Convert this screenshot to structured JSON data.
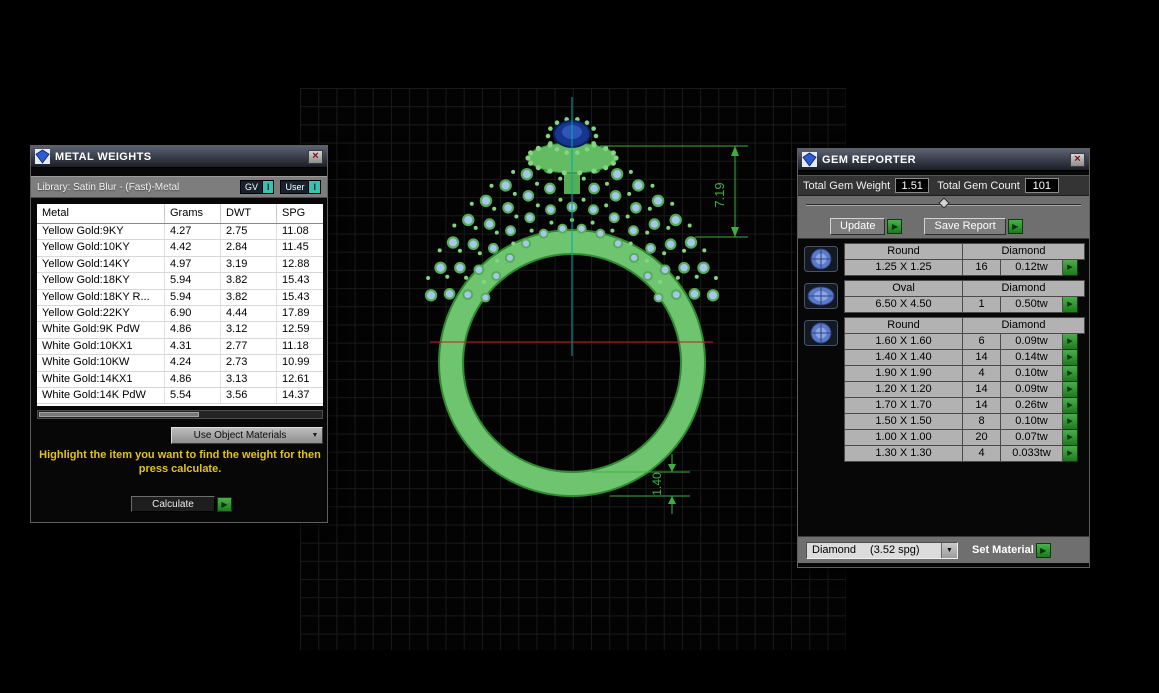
{
  "colors": {
    "accent_green": "#2f9e2f",
    "teal_badge": "#38c3b0",
    "instruction_yellow": "#e2c31b",
    "dimension_green": "#3fae3f",
    "ring_green": "#6fc46f",
    "gem_blue": "#a6c6ee",
    "axis_teal": "#00a8a8",
    "axis_red": "#bb2222"
  },
  "icons": {
    "close": "×",
    "dropdown_arrow": "▼",
    "action_arrow": "▶",
    "info_badge": "I"
  },
  "viewport": {
    "dims": {
      "vertical": "7.19",
      "horizontal": "1.40"
    }
  },
  "metal_weights": {
    "title": "METAL WEIGHTS",
    "library_label": "Library: Satin Blur - (Fast)-Metal",
    "gv_label": "GV",
    "user_label": "User",
    "columns": [
      "Metal",
      "Grams",
      "DWT",
      "SPG"
    ],
    "rows": [
      {
        "metal": "Yellow Gold:9KY",
        "grams": "4.27",
        "dwt": "2.75",
        "spg": "11.08"
      },
      {
        "metal": "Yellow Gold:10KY",
        "grams": "4.42",
        "dwt": "2.84",
        "spg": "11.45"
      },
      {
        "metal": "Yellow Gold:14KY",
        "grams": "4.97",
        "dwt": "3.19",
        "spg": "12.88"
      },
      {
        "metal": "Yellow Gold:18KY",
        "grams": "5.94",
        "dwt": "3.82",
        "spg": "15.43"
      },
      {
        "metal": "Yellow Gold:18KY R...",
        "grams": "5.94",
        "dwt": "3.82",
        "spg": "15.43"
      },
      {
        "metal": "Yellow Gold:22KY",
        "grams": "6.90",
        "dwt": "4.44",
        "spg": "17.89"
      },
      {
        "metal": "White Gold:9K PdW",
        "grams": "4.86",
        "dwt": "3.12",
        "spg": "12.59"
      },
      {
        "metal": "White Gold:10KX1",
        "grams": "4.31",
        "dwt": "2.77",
        "spg": "11.18"
      },
      {
        "metal": "White Gold:10KW",
        "grams": "4.24",
        "dwt": "2.73",
        "spg": "10.99"
      },
      {
        "metal": "White Gold:14KX1",
        "grams": "4.86",
        "dwt": "3.13",
        "spg": "12.61"
      },
      {
        "metal": "White Gold:14K PdW",
        "grams": "5.54",
        "dwt": "3.56",
        "spg": "14.37"
      }
    ],
    "dropdown_value": "Use Object Materials",
    "instruction": "Highlight the item you want to find the weight for then press calculate.",
    "calculate_label": "Calculate"
  },
  "gem_reporter": {
    "title": "GEM REPORTER",
    "total_weight_label": "Total Gem Weight",
    "total_weight_value": "1.51",
    "total_count_label": "Total Gem Count",
    "total_count_value": "101",
    "update_label": "Update",
    "save_report_label": "Save Report",
    "groups": [
      {
        "icon": "round-gem-icon",
        "shape": "Round",
        "material": "Diamond",
        "rows": [
          {
            "size": "1.25 X 1.25",
            "count": "16",
            "weight": "0.12tw"
          }
        ]
      },
      {
        "icon": "oval-gem-icon",
        "shape": "Oval",
        "material": "Diamond",
        "rows": [
          {
            "size": "6.50 X 4.50",
            "count": "1",
            "weight": "0.50tw"
          }
        ]
      },
      {
        "icon": "round-gem-icon",
        "shape": "Round",
        "material": "Diamond",
        "rows": [
          {
            "size": "1.60 X 1.60",
            "count": "6",
            "weight": "0.09tw"
          },
          {
            "size": "1.40 X 1.40",
            "count": "14",
            "weight": "0.14tw"
          },
          {
            "size": "1.90 X 1.90",
            "count": "4",
            "weight": "0.10tw"
          },
          {
            "size": "1.20 X 1.20",
            "count": "14",
            "weight": "0.09tw"
          },
          {
            "size": "1.70 X 1.70",
            "count": "14",
            "weight": "0.26tw"
          },
          {
            "size": "1.50 X 1.50",
            "count": "8",
            "weight": "0.10tw"
          },
          {
            "size": "1.00 X 1.00",
            "count": "20",
            "weight": "0.07tw"
          },
          {
            "size": "1.30 X 1.30",
            "count": "4",
            "weight": "0.033tw"
          }
        ]
      }
    ],
    "material_value": "Diamond",
    "material_spg": "(3.52 spg)",
    "set_material_label": "Set Material"
  }
}
